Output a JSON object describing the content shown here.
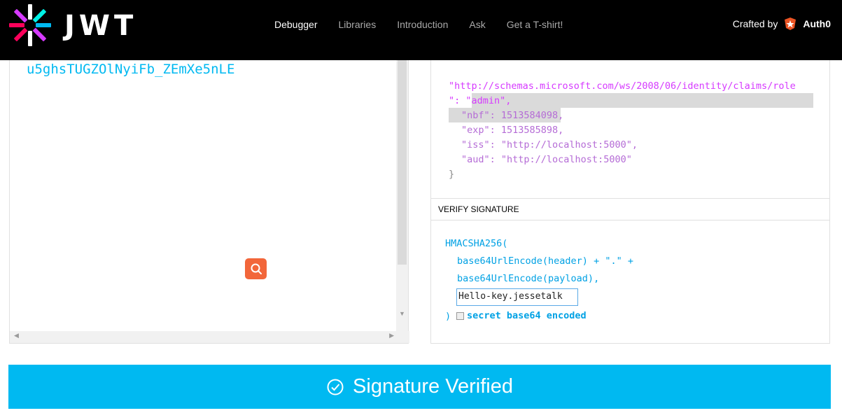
{
  "header": {
    "brand": "JWT",
    "nav": [
      {
        "label": "Debugger",
        "active": true
      },
      {
        "label": "Libraries",
        "active": false
      },
      {
        "label": "Introduction",
        "active": false
      },
      {
        "label": "Ask",
        "active": false
      },
      {
        "label": "Get a T-shirt!",
        "active": false
      }
    ],
    "crafted_by": "Crafted by",
    "auth0": "Auth0"
  },
  "encoded": {
    "visible_text": "u5ghsTUGZOlNyiFb_ZEmXe5nLE"
  },
  "payload": {
    "role_claim_key": "\"http://schemas.microsoft.com/ws/2008/06/identity/claims/role",
    "role_claim_value": "\": \"admin\",",
    "nbf_line": "\"nbf\": 1513584098,",
    "exp_line": "\"exp\": 1513585898,",
    "iss_line": "\"iss\": \"http://localhost:5000\",",
    "aud_line": "\"aud\": \"http://localhost:5000\"",
    "close_brace": "}"
  },
  "verify": {
    "header": "VERIFY SIGNATURE",
    "func": "HMACSHA256(",
    "arg1": "base64UrlEncode(header) + \".\" +",
    "arg2": "base64UrlEncode(payload),",
    "secret_value": "Hello-key.jessetalk",
    "close_paren": ")",
    "checkbox_label": "secret base64 encoded",
    "checkbox_checked": false
  },
  "status": {
    "label": "Signature Verified"
  },
  "colors": {
    "accent": "#00b9f1",
    "orange": "#f2663a"
  }
}
